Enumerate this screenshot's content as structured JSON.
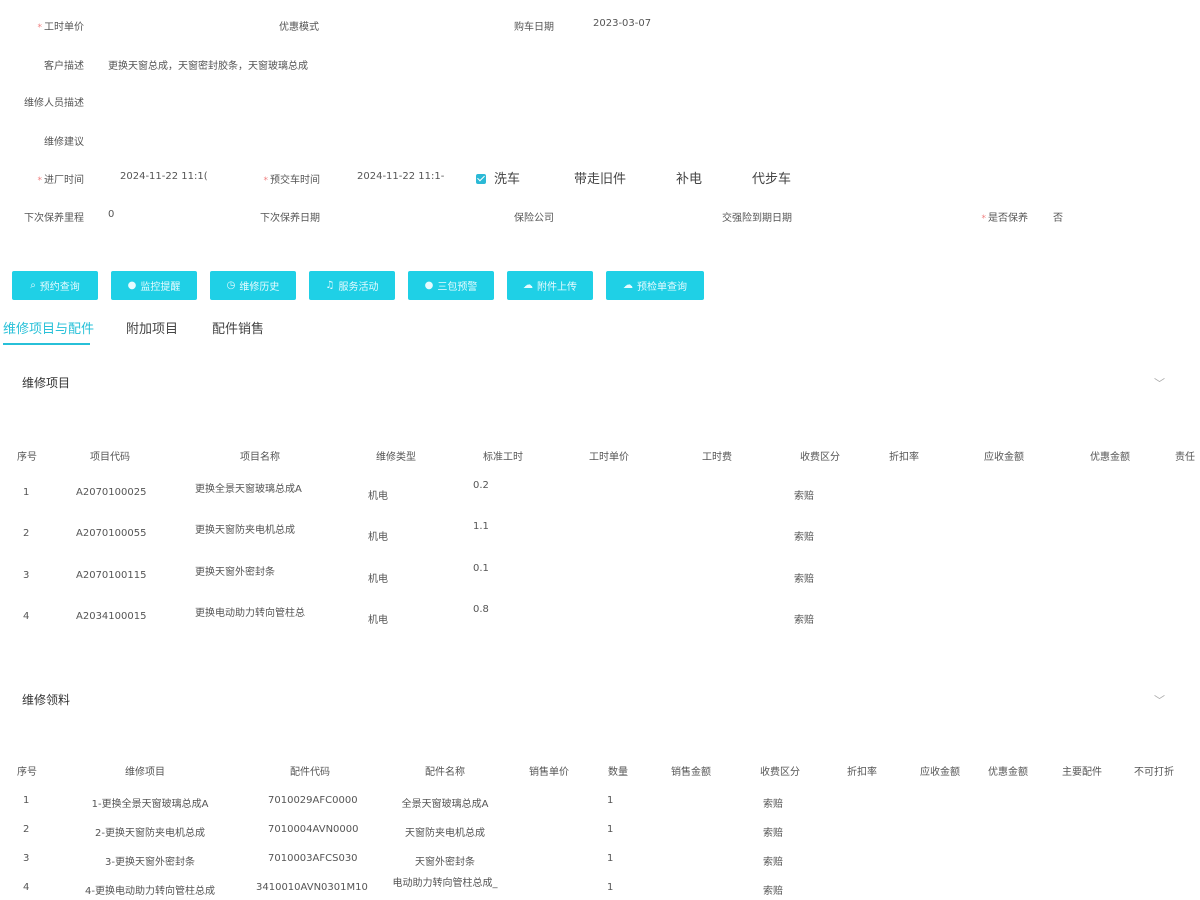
{
  "form": {
    "labor_price_label": "工时单价",
    "discount_mode_label": "优惠模式",
    "purchase_date_label": "购车日期",
    "purchase_date_value": "2023-03-07",
    "customer_desc_label": "客户描述",
    "customer_desc_value": "更换天窗总成，天窗密封胶条，天窗玻璃总成",
    "repairer_desc_label": "维修人员描述",
    "repair_advice_label": "维修建议",
    "entry_time_label": "进厂时间",
    "entry_time_value": "2024-11-22 11:1(",
    "expected_delivery_label": "预交车时间",
    "expected_delivery_value": "2024-11-22 11:1-",
    "wash_label": "洗车",
    "take_old_parts_label": "带走旧件",
    "recharge_label": "补电",
    "courtesy_car_label": "代步车",
    "next_mileage_label": "下次保养里程",
    "next_mileage_value": "0",
    "next_date_label": "下次保养日期",
    "insurance_label": "保险公司",
    "insurance_expiry_label": "交强险到期日期",
    "is_maintenance_label": "是否保养",
    "is_maintenance_value": "否"
  },
  "buttons": [
    {
      "label": "预约查询",
      "icon": "search-icon"
    },
    {
      "label": "监控提醒",
      "icon": "alert-icon"
    },
    {
      "label": "维修历史",
      "icon": "clock-icon"
    },
    {
      "label": "服务活动",
      "icon": "bell-icon"
    },
    {
      "label": "三包预警",
      "icon": "warning-icon"
    },
    {
      "label": "附件上传",
      "icon": "cloud-upload-icon"
    },
    {
      "label": "预检单查询",
      "icon": "cloud-icon"
    }
  ],
  "tabs": [
    "维修项目与配件",
    "附加项目",
    "配件销售"
  ],
  "items_section": {
    "title": "维修项目",
    "headers": [
      "序号",
      "项目代码",
      "项目名称",
      "维修类型",
      "标准工时",
      "工时单价",
      "工时费",
      "收费区分",
      "折扣率",
      "应收金额",
      "优惠金额",
      "责任"
    ],
    "rows": [
      {
        "no": "1",
        "code": "A2070100025",
        "name": "更换全景天窗玻璃总成A",
        "type": "机电",
        "hours": "0.2",
        "charge": "索赔"
      },
      {
        "no": "2",
        "code": "A2070100055",
        "name": "更换天窗防夹电机总成",
        "type": "机电",
        "hours": "1.1",
        "charge": "索赔"
      },
      {
        "no": "3",
        "code": "A2070100115",
        "name": "更换天窗外密封条",
        "type": "机电",
        "hours": "0.1",
        "charge": "索赔"
      },
      {
        "no": "4",
        "code": "A2034100015",
        "name": "更换电动助力转向管柱总",
        "type": "机电",
        "hours": "0.8",
        "charge": "索赔"
      }
    ]
  },
  "materials_section": {
    "title": "维修领料",
    "headers": [
      "序号",
      "维修项目",
      "配件代码",
      "配件名称",
      "销售单价",
      "数量",
      "销售金额",
      "收费区分",
      "折扣率",
      "应收金额",
      "优惠金额",
      "主要配件",
      "不可打折"
    ],
    "rows": [
      {
        "no": "1",
        "item": "1-更换全景天窗玻璃总成A",
        "code": "7010029AFC0000",
        "name": "全景天窗玻璃总成A",
        "qty": "1",
        "charge": "索赔"
      },
      {
        "no": "2",
        "item": "2-更换天窗防夹电机总成",
        "code": "7010004AVN0000",
        "name": "天窗防夹电机总成",
        "qty": "1",
        "charge": "索赔"
      },
      {
        "no": "3",
        "item": "3-更换天窗外密封条",
        "code": "7010003AFCS030",
        "name": "天窗外密封条",
        "qty": "1",
        "charge": "索赔"
      },
      {
        "no": "4",
        "item": "4-更换电动助力转向管柱总成",
        "code": "3410010AVN0301M10",
        "name": "电动助力转向管柱总成_",
        "qty": "1",
        "charge": "索赔"
      }
    ]
  }
}
